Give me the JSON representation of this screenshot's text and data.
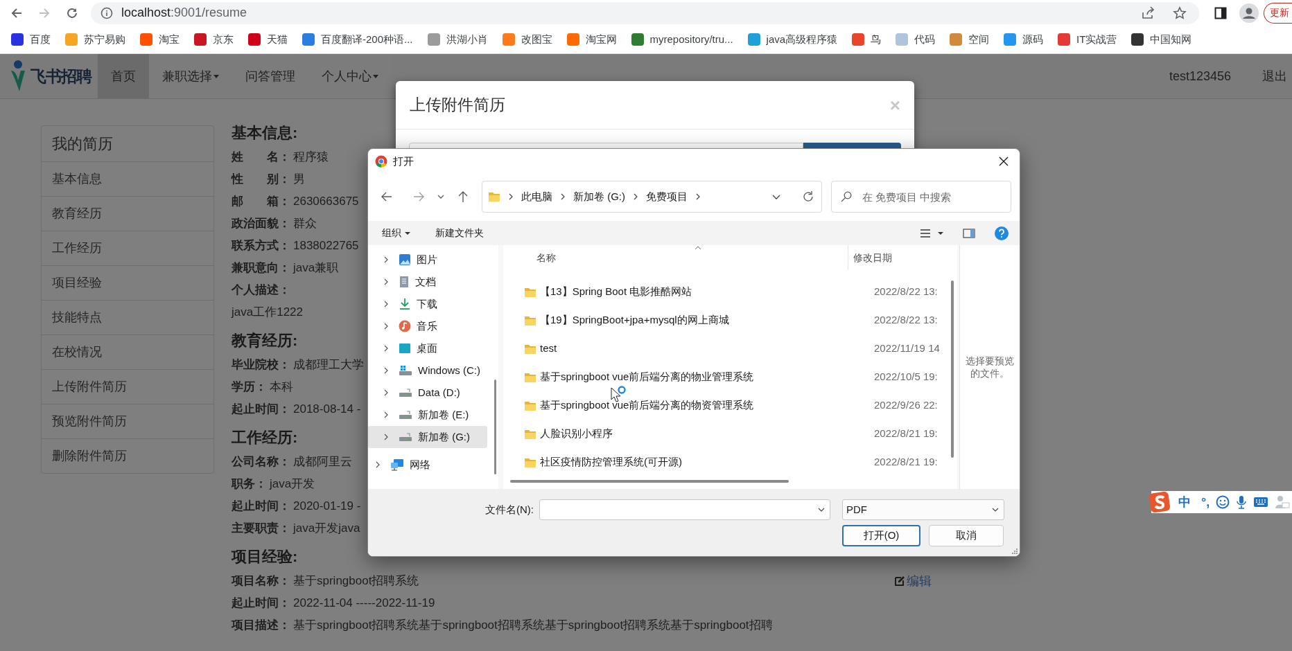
{
  "browser": {
    "url_host": "localhost",
    "url_path": ":9001/resume",
    "update_label": "更新",
    "bookmarks": [
      {
        "label": "百度",
        "color": "#2932e1"
      },
      {
        "label": "苏宁易购",
        "color": "#f5a623"
      },
      {
        "label": "淘宝",
        "color": "#ff5000"
      },
      {
        "label": "京东",
        "color": "#c91623"
      },
      {
        "label": "天猫",
        "color": "#d0021b"
      },
      {
        "label": "百度翻译-200种语...",
        "color": "#2a7de1"
      },
      {
        "label": "洪湖小肖",
        "color": "#9b9b9b"
      },
      {
        "label": "改图宝",
        "color": "#ff7a1a"
      },
      {
        "label": "淘宝网",
        "color": "#ff6a00"
      },
      {
        "label": "myrepository/tru...",
        "color": "#2e7d32"
      },
      {
        "label": "java高级程序猿",
        "color": "#1ea0d8"
      },
      {
        "label": "鸟",
        "color": "#e8452c"
      },
      {
        "label": "代码",
        "color": "#b0c4de"
      },
      {
        "label": "空间",
        "color": "#d08a3a"
      },
      {
        "label": "源码",
        "color": "#2496ed"
      },
      {
        "label": "IT实战营",
        "color": "#e53935"
      },
      {
        "label": "中国知网",
        "color": "#333333"
      }
    ]
  },
  "navbar": {
    "logo": "飞书招聘",
    "items": [
      {
        "label": "首页",
        "selected": true,
        "dropdown": false
      },
      {
        "label": "兼职选择",
        "selected": false,
        "dropdown": true
      },
      {
        "label": "问答管理",
        "selected": false,
        "dropdown": false
      },
      {
        "label": "个人中心",
        "selected": false,
        "dropdown": true
      }
    ],
    "user": "test123456",
    "logout": "退出"
  },
  "sidebar": {
    "title": "我的简历",
    "items": [
      "基本信息",
      "教育经历",
      "工作经历",
      "项目经验",
      "技能特点",
      "在校情况",
      "上传附件简历",
      "预览附件简历",
      "删除附件简历"
    ]
  },
  "resume": {
    "sections": [
      {
        "title": "基本信息:",
        "fields": [
          {
            "label": "姓　　名：",
            "value": "程序猿"
          },
          {
            "label": "性　　别：",
            "value": "男"
          },
          {
            "label": "邮　　箱：",
            "value": "2630663675"
          },
          {
            "label": "政治面貌：",
            "value": "群众"
          },
          {
            "label": "联系方式：",
            "value": "1838022765"
          },
          {
            "label": "兼职意向：",
            "value": "java兼职"
          },
          {
            "label": "个人描述：",
            "value": "java工作1222",
            "kind": "block"
          }
        ]
      },
      {
        "title": "教育经历:",
        "fields": [
          {
            "label": "毕业院校：",
            "value": "成都理工大学"
          },
          {
            "label": "学历：",
            "value": "本科"
          },
          {
            "label": "起止时间：",
            "value": "2018-08-14 -"
          }
        ]
      },
      {
        "title": "工作经历:",
        "fields": [
          {
            "label": "公司名称：",
            "value": "成都阿里云"
          },
          {
            "label": "职务：",
            "value": "java开发"
          },
          {
            "label": "起止时间：",
            "value": "2020-01-19 -"
          },
          {
            "label": "主要职责：",
            "value": "java开发java"
          }
        ]
      },
      {
        "title": "项目经验:",
        "fields": [
          {
            "label": "项目名称：",
            "value": "基于springboot招聘系统",
            "action": "编辑"
          },
          {
            "label": "起止时间：",
            "value": "2022-11-04 -----2022-11-19"
          },
          {
            "label": "项目描述：",
            "value": "基于springboot招聘系统基于springboot招聘系统基于springboot招聘系统基于springboot招聘"
          }
        ]
      }
    ]
  },
  "upload_modal": {
    "title": "上传附件简历",
    "close": "×"
  },
  "file_dialog": {
    "title": "打开",
    "breadcrumbs": [
      "此电脑",
      "新加卷 (G:)",
      "免费项目"
    ],
    "search_placeholder": "在 免费项目 中搜索",
    "organize": "组织",
    "new_folder": "新建文件夹",
    "nav_tree": {
      "this_pc_children": [
        {
          "label": "图片",
          "kind": "pictures",
          "selected": false
        },
        {
          "label": "文档",
          "kind": "documents",
          "selected": false
        },
        {
          "label": "下载",
          "kind": "downloads",
          "selected": false
        },
        {
          "label": "音乐",
          "kind": "music",
          "selected": false
        },
        {
          "label": "桌面",
          "kind": "desktop",
          "selected": false
        },
        {
          "label": "Windows (C:)",
          "kind": "system_drive",
          "selected": false
        },
        {
          "label": "Data (D:)",
          "kind": "drive",
          "selected": false
        },
        {
          "label": "新加卷 (E:)",
          "kind": "drive",
          "selected": false
        },
        {
          "label": "新加卷 (G:)",
          "kind": "drive",
          "selected": true
        }
      ],
      "root_items": [
        {
          "label": "网络",
          "kind": "network",
          "selected": false
        }
      ]
    },
    "columns": [
      "名称",
      "修改日期"
    ],
    "files": [
      {
        "name": "【13】Spring Boot 电影推酷网站",
        "modified": "2022/8/22 13:"
      },
      {
        "name": "【19】SpringBoot+jpa+mysql的网上商城",
        "modified": "2022/8/22 13:"
      },
      {
        "name": "test",
        "modified": "2022/11/19 14"
      },
      {
        "name": "基于springboot vue前后端分离的物业管理系统",
        "modified": "2022/10/5 19:"
      },
      {
        "name": "基于springboot vue前后端分离的物资管理系统",
        "modified": "2022/9/26 22:"
      },
      {
        "name": "人脸识别小程序",
        "modified": "2022/8/21 19:"
      },
      {
        "name": "社区疫情防控管理系统(可开源)",
        "modified": "2022/8/21 19:"
      }
    ],
    "preview_text": "选择要预览的文件。",
    "filename_label": "文件名(N):",
    "file_type": "PDF",
    "buttons": [
      {
        "label": "打开(O)",
        "kind": "primary"
      },
      {
        "label": "取消",
        "kind": "secondary"
      }
    ]
  },
  "ime_toolbar": {
    "mode": "中",
    "punctuation": "°,"
  }
}
